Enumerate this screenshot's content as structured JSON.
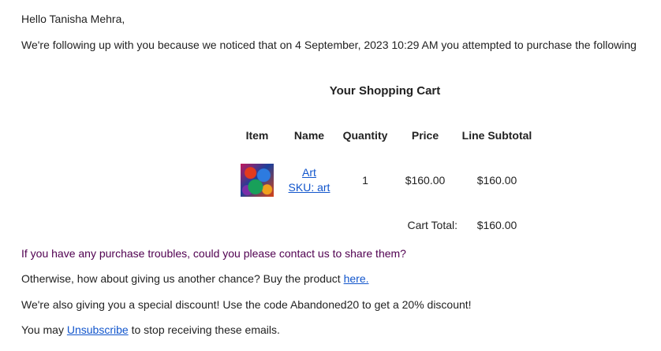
{
  "email": {
    "greeting": "Hello Tanisha Mehra,",
    "intro": "We're following up with you because we noticed that on 4 September, 2023 10:29 AM you attempted to purchase the following",
    "cart_title": "Your Shopping Cart",
    "columns": {
      "item": "Item",
      "name": "Name",
      "quantity": "Quantity",
      "price": "Price",
      "line_subtotal": "Line Subtotal"
    },
    "items": [
      {
        "image": "artwork-thumbnail",
        "name": "Art",
        "sku": "SKU: art",
        "quantity": "1",
        "price": "$160.00",
        "line_subtotal": "$160.00"
      }
    ],
    "cart_total_label": "Cart Total:",
    "cart_total_value": "$160.00",
    "troubles": "If you have any purchase troubles, could you please contact us to share them?",
    "another_chance_prefix": "Otherwise, how about giving us another chance? Buy the product ",
    "another_chance_link": "here.",
    "discount": "We're also giving you a special discount! Use the code Abandoned20 to get a 20% discount!",
    "unsubscribe_prefix": "You may ",
    "unsubscribe_link": "Unsubscribe",
    "unsubscribe_suffix": " to stop receiving these emails."
  },
  "colors": {
    "link": "#1155cc",
    "text": "#222222",
    "visited_text": "#500050"
  }
}
